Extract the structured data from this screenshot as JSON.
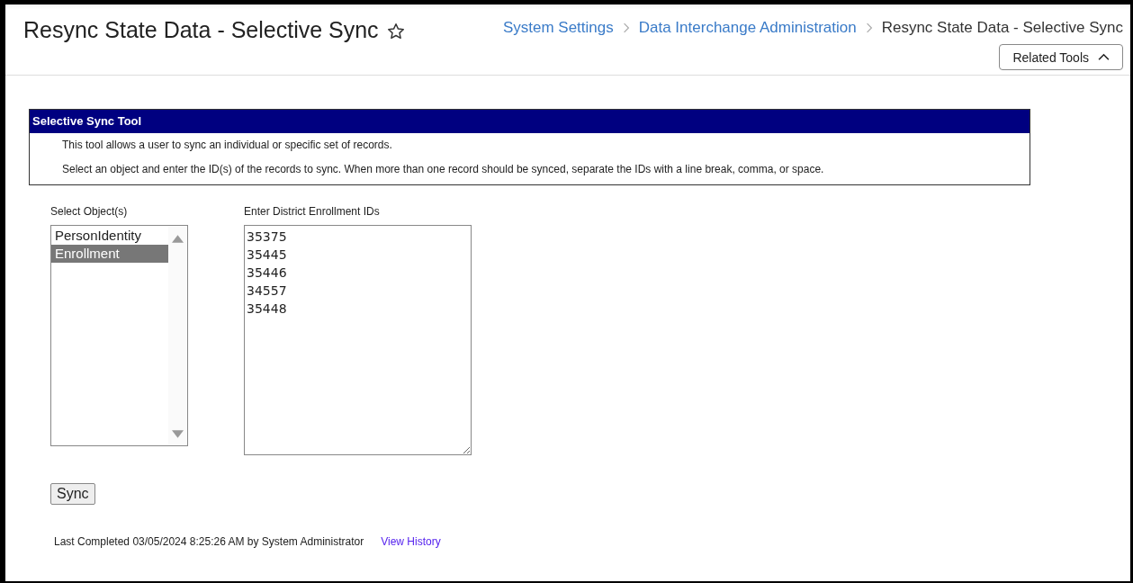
{
  "header": {
    "title": "Resync State Data - Selective Sync",
    "favorite": false,
    "breadcrumbs": [
      {
        "label": "System Settings",
        "kind": "link"
      },
      {
        "label": "Data Interchange Administration",
        "kind": "link"
      },
      {
        "label": "Resync State Data - Selective Sync",
        "kind": "current"
      }
    ],
    "related_tools": {
      "label": "Related Tools",
      "expanded": true
    }
  },
  "panel": {
    "title": "Selective Sync Tool",
    "lines": [
      "This tool allows a user to sync an individual or specific set of records.",
      "Select an object and enter the ID(s) of the records to sync. When more than one record should be synced, separate the IDs with a line break, comma, or space."
    ]
  },
  "objects": {
    "label": "Select Object(s)",
    "items": [
      {
        "label": "PersonIdentity",
        "selected": false
      },
      {
        "label": "Enrollment",
        "selected": true
      }
    ]
  },
  "ids": {
    "label": "Enter District Enrollment IDs",
    "lines": [
      "35375",
      "35445",
      "35446",
      "34557",
      "35448"
    ]
  },
  "sync_button": "Sync",
  "footer": {
    "text": "Last Completed 03/05/2024 8:25:26 AM by System Administrator",
    "link": "View History"
  }
}
